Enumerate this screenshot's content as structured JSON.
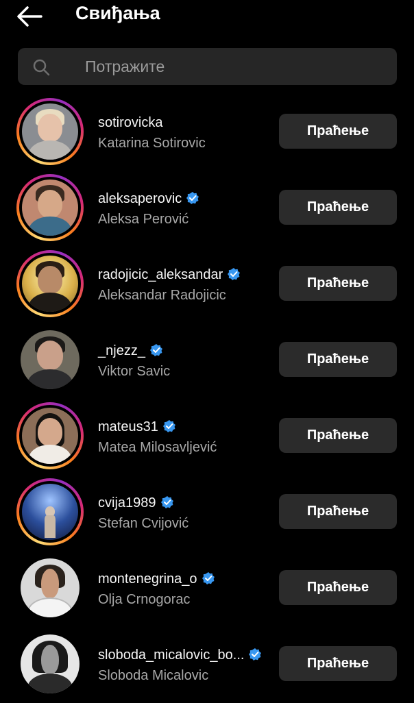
{
  "header": {
    "title": "Свиђања",
    "back_icon": "arrow-left-icon"
  },
  "search": {
    "placeholder": "Потражите",
    "icon": "search-icon"
  },
  "colors": {
    "background": "#000000",
    "button": "#2b2b2b",
    "verified": "#3897f0",
    "secondary_text": "#a8a8a8"
  },
  "users": [
    {
      "username": "sotirovicka",
      "full_name": "Katarina Sotirovic",
      "verified": false,
      "story_ring": true,
      "button": "Праћење"
    },
    {
      "username": "aleksaperovic",
      "full_name": "Aleksa Perović",
      "verified": true,
      "story_ring": true,
      "button": "Праћење"
    },
    {
      "username": "radojicic_aleksandar",
      "full_name": "Aleksandar Radojicic",
      "verified": true,
      "story_ring": true,
      "button": "Праћење"
    },
    {
      "username": "_njezz_",
      "full_name": "Viktor Savic",
      "verified": true,
      "story_ring": false,
      "button": "Праћење"
    },
    {
      "username": "mateus31",
      "full_name": "Matea Milosavljević",
      "verified": true,
      "story_ring": true,
      "button": "Праћење"
    },
    {
      "username": "cvija1989",
      "full_name": "Stefan Cvijović",
      "verified": true,
      "story_ring": true,
      "button": "Праћење"
    },
    {
      "username": "montenegrina_o",
      "full_name": "Olja Crnogorac",
      "verified": true,
      "story_ring": false,
      "button": "Праћење"
    },
    {
      "username": "sloboda_micalovic_bo...",
      "full_name": "Sloboda Micalovic",
      "verified": true,
      "story_ring": false,
      "button": "Праћење"
    }
  ]
}
